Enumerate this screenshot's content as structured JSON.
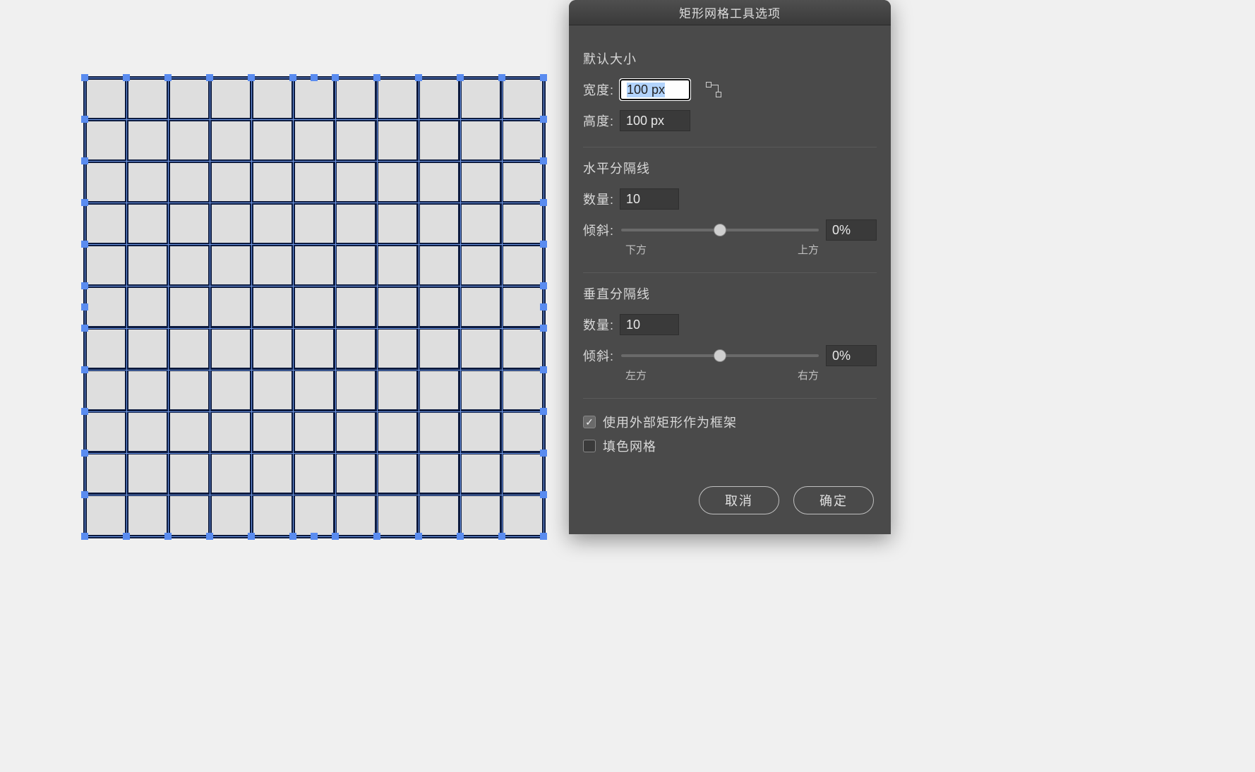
{
  "dialog": {
    "title": "矩形网格工具选项",
    "default_size": {
      "heading": "默认大小",
      "width_label": "宽度:",
      "width_value": "100 px",
      "height_label": "高度:",
      "height_value": "100 px"
    },
    "horizontal": {
      "heading": "水平分隔线",
      "count_label": "数量:",
      "count_value": "10",
      "skew_label": "倾斜:",
      "skew_value": "0%",
      "skew_left": "下方",
      "skew_right": "上方"
    },
    "vertical": {
      "heading": "垂直分隔线",
      "count_label": "数量:",
      "count_value": "10",
      "skew_label": "倾斜:",
      "skew_value": "0%",
      "skew_left": "左方",
      "skew_right": "右方"
    },
    "use_outer_rect_label": "使用外部矩形作为框架",
    "use_outer_rect_checked": true,
    "fill_grid_label": "填色网格",
    "fill_grid_checked": false,
    "cancel_label": "取消",
    "ok_label": "确定"
  },
  "grid": {
    "cols": 11,
    "rows": 11
  }
}
